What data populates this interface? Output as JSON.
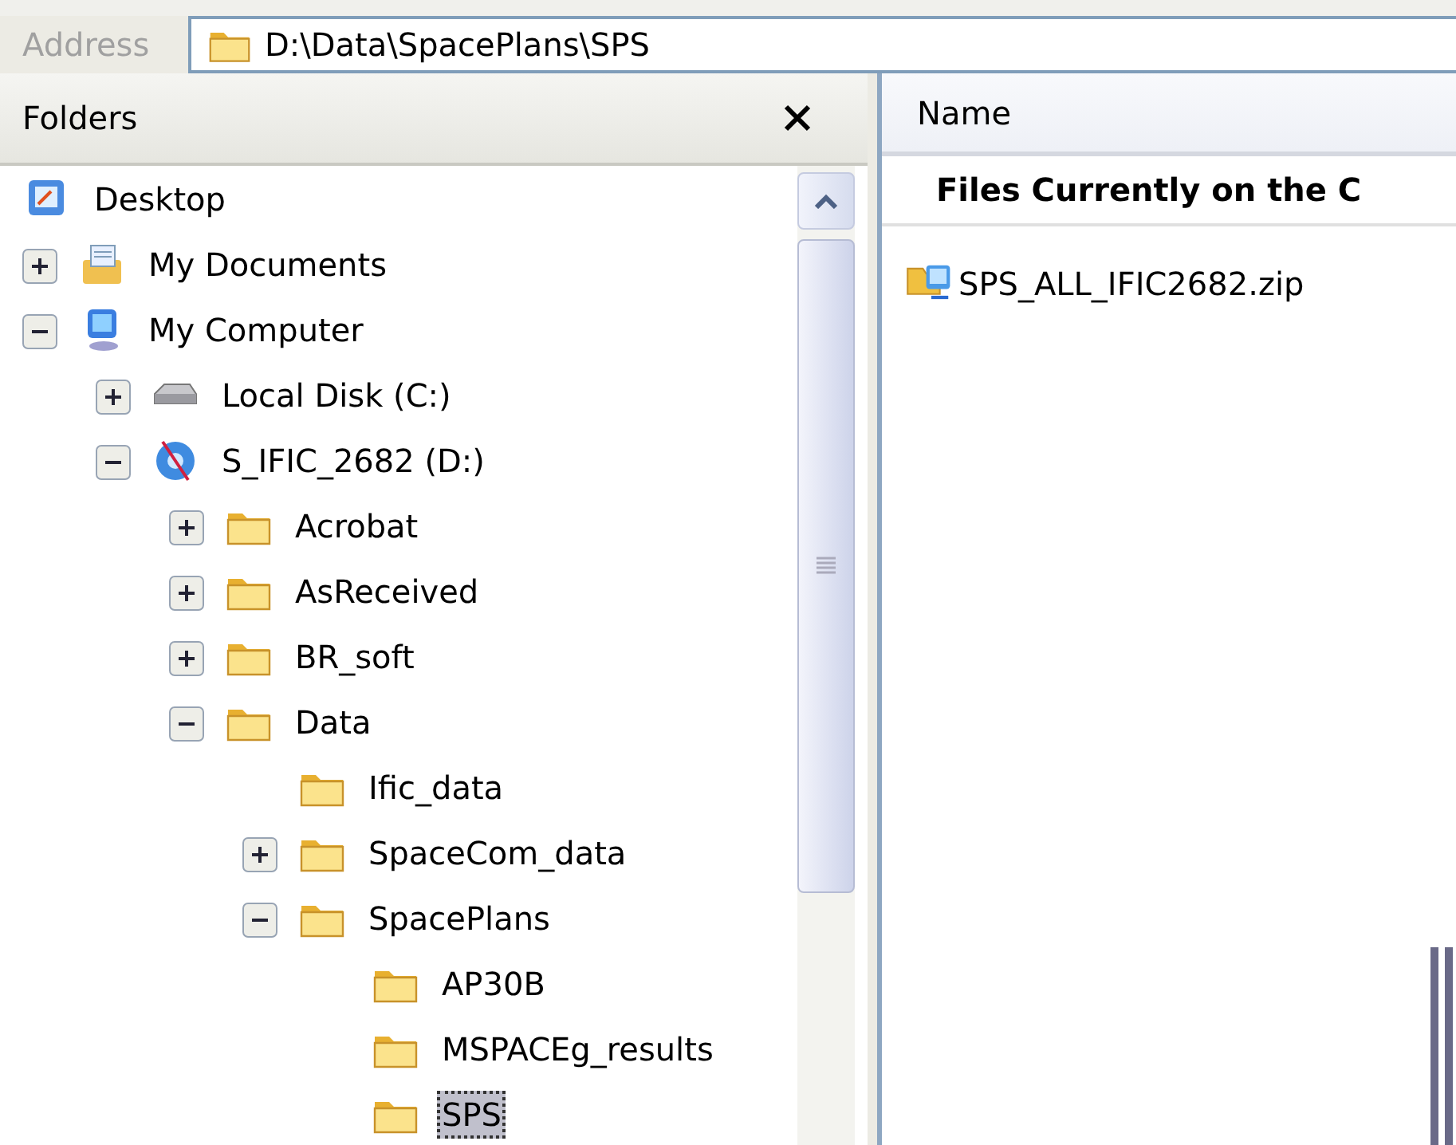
{
  "address": {
    "label": "Address",
    "path": "D:\\Data\\SpacePlans\\SPS"
  },
  "folders_pane": {
    "title": "Folders"
  },
  "tree": [
    {
      "label": "Desktop",
      "kind": "desktop",
      "selected": false,
      "children": [
        {
          "label": "My Documents",
          "kind": "documents",
          "expanded": false,
          "selected": false
        },
        {
          "label": "My Computer",
          "kind": "computer",
          "expanded": true,
          "selected": false,
          "children": [
            {
              "label": "Local Disk (C:)",
              "kind": "disk",
              "expanded": false,
              "selected": false
            },
            {
              "label": "S_IFIC_2682 (D:)",
              "kind": "cd",
              "expanded": true,
              "selected": false,
              "children": [
                {
                  "label": "Acrobat",
                  "kind": "folder",
                  "expanded": false,
                  "selected": false
                },
                {
                  "label": "AsReceived",
                  "kind": "folder",
                  "expanded": false,
                  "selected": false
                },
                {
                  "label": "BR_soft",
                  "kind": "folder",
                  "expanded": false,
                  "selected": false
                },
                {
                  "label": "Data",
                  "kind": "folder",
                  "expanded": true,
                  "selected": false,
                  "children": [
                    {
                      "label": "Ific_data",
                      "kind": "folder",
                      "selected": false
                    },
                    {
                      "label": "SpaceCom_data",
                      "kind": "folder",
                      "expanded": false,
                      "selected": false
                    },
                    {
                      "label": "SpacePlans",
                      "kind": "folder",
                      "expanded": true,
                      "selected": false,
                      "children": [
                        {
                          "label": "AP30B",
                          "kind": "folder",
                          "selected": false
                        },
                        {
                          "label": "MSPACEg_results",
                          "kind": "folder",
                          "selected": false
                        },
                        {
                          "label": "SPS",
                          "kind": "folder",
                          "selected": true
                        }
                      ]
                    }
                  ]
                }
              ]
            }
          ]
        }
      ]
    }
  ],
  "file_list": {
    "columns": [
      "Name"
    ],
    "groups": [
      {
        "heading": "Files Currently on the C",
        "items": [
          {
            "name": "SPS_ALL_IFIC2682.zip",
            "kind": "zip"
          }
        ]
      }
    ]
  }
}
